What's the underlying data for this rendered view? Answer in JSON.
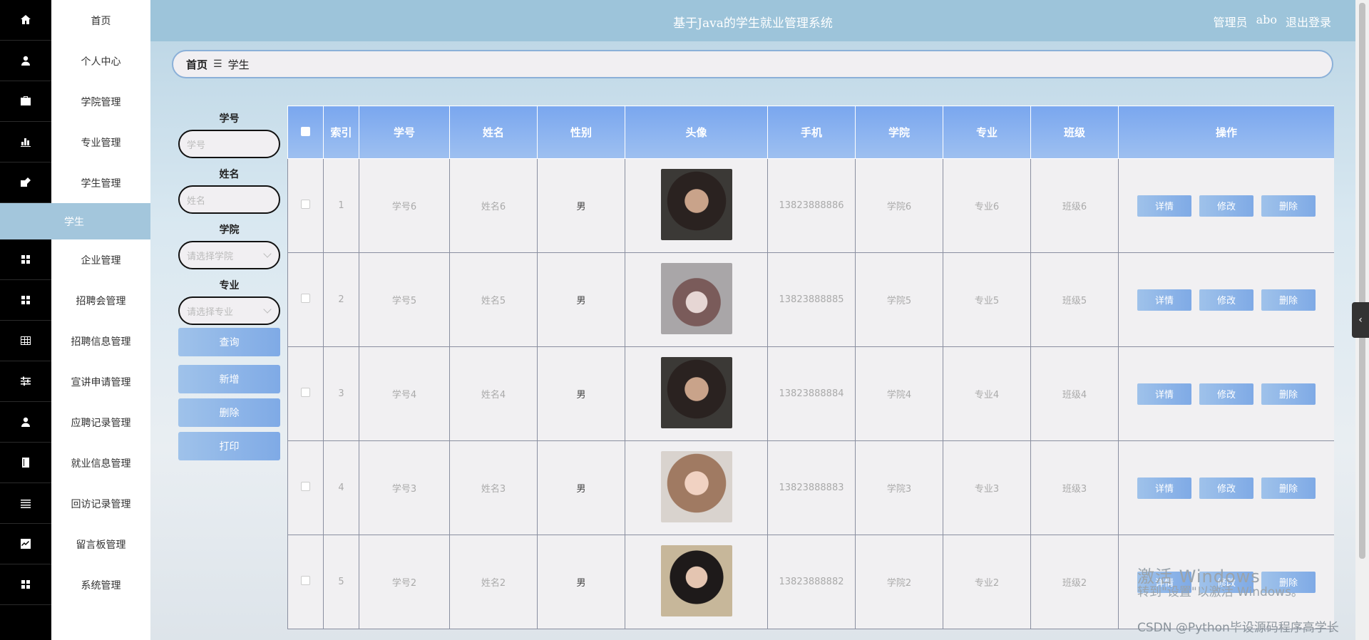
{
  "header": {
    "title": "基于Java的学生就业管理系统",
    "role": "管理员",
    "username": "abo",
    "logout": "退出登录"
  },
  "sidebar": {
    "items": [
      {
        "label": "首页",
        "icon": "home-icon"
      },
      {
        "label": "个人中心",
        "icon": "user-icon"
      },
      {
        "label": "学院管理",
        "icon": "briefcase-icon"
      },
      {
        "label": "专业管理",
        "icon": "bar-chart-icon"
      },
      {
        "label": "学生管理",
        "icon": "edit-icon"
      },
      {
        "label": "企业管理",
        "icon": "grid-icon"
      },
      {
        "label": "招聘会管理",
        "icon": "grid-icon"
      },
      {
        "label": "招聘信息管理",
        "icon": "table-icon"
      },
      {
        "label": "宣讲申请管理",
        "icon": "sliders-icon"
      },
      {
        "label": "应聘记录管理",
        "icon": "user-icon"
      },
      {
        "label": "就业信息管理",
        "icon": "book-icon"
      },
      {
        "label": "回访记录管理",
        "icon": "list-icon"
      },
      {
        "label": "留言板管理",
        "icon": "chart-line-icon"
      },
      {
        "label": "系统管理",
        "icon": "grid-icon"
      }
    ],
    "active_sub": "学生"
  },
  "breadcrumb": {
    "home": "首页",
    "separator": "☰",
    "current": "学生"
  },
  "search": {
    "student_no_label": "学号",
    "student_no_placeholder": "学号",
    "name_label": "姓名",
    "name_placeholder": "姓名",
    "college_label": "学院",
    "college_placeholder": "请选择学院",
    "major_label": "专业",
    "major_placeholder": "请选择专业",
    "query": "查询",
    "add": "新增",
    "delete": "删除",
    "print": "打印"
  },
  "table": {
    "headers": [
      "索引",
      "学号",
      "姓名",
      "性别",
      "头像",
      "手机",
      "学院",
      "专业",
      "班级",
      "操作"
    ],
    "rows": [
      {
        "index": "1",
        "no": "学号6",
        "name": "姓名6",
        "sex": "男",
        "phone": "13823888886",
        "college": "学院6",
        "major": "专业6",
        "cls": "班级6"
      },
      {
        "index": "2",
        "no": "学号5",
        "name": "姓名5",
        "sex": "男",
        "phone": "13823888885",
        "college": "学院5",
        "major": "专业5",
        "cls": "班级5"
      },
      {
        "index": "3",
        "no": "学号4",
        "name": "姓名4",
        "sex": "男",
        "phone": "13823888884",
        "college": "学院4",
        "major": "专业4",
        "cls": "班级4"
      },
      {
        "index": "4",
        "no": "学号3",
        "name": "姓名3",
        "sex": "男",
        "phone": "13823888883",
        "college": "学院3",
        "major": "专业3",
        "cls": "班级3"
      },
      {
        "index": "5",
        "no": "学号2",
        "name": "姓名2",
        "sex": "男",
        "phone": "13823888882",
        "college": "学院2",
        "major": "专业2",
        "cls": "班级2"
      }
    ],
    "actions": {
      "detail": "详情",
      "edit": "修改",
      "delete": "删除"
    }
  },
  "watermark": {
    "line1": "激活 Windows",
    "line2": "转到\"设置\"以激活 Windows。",
    "csdn": "CSDN @Python毕设源码程序高学长"
  },
  "colors": {
    "header": "#9dc4da",
    "active_menu": "#a3c6dc",
    "button": "#7faae6",
    "rail": "#000000"
  }
}
